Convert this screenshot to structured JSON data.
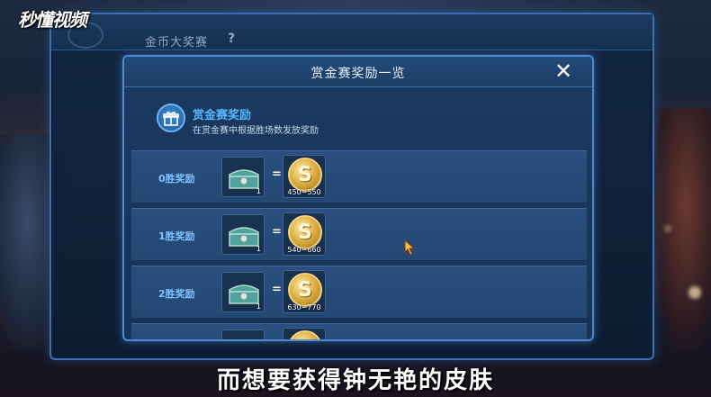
{
  "watermark": "秒懂视频",
  "background_screen": {
    "title": "金币大奖赛",
    "help": "?"
  },
  "modal": {
    "title": "赏金赛奖励一览",
    "close": "✕",
    "section": {
      "title": "赏金赛奖励",
      "description": "在赏金赛中根据胜场数发放奖励",
      "icon": "gift-icon"
    },
    "rows": [
      {
        "label": "0胜奖励",
        "chest_count": "1",
        "coin_letter": "S",
        "coin_range": "450~550"
      },
      {
        "label": "1胜奖励",
        "chest_count": "1",
        "coin_letter": "S",
        "coin_range": "540~660"
      },
      {
        "label": "2胜奖励",
        "chest_count": "1",
        "coin_letter": "S",
        "coin_range": "630~770"
      }
    ]
  },
  "subtitle": "而想要获得钟无艳的皮肤",
  "colors": {
    "accent": "#58b8ff",
    "frame": "#4f8bd0",
    "coin": "#e0b248"
  }
}
